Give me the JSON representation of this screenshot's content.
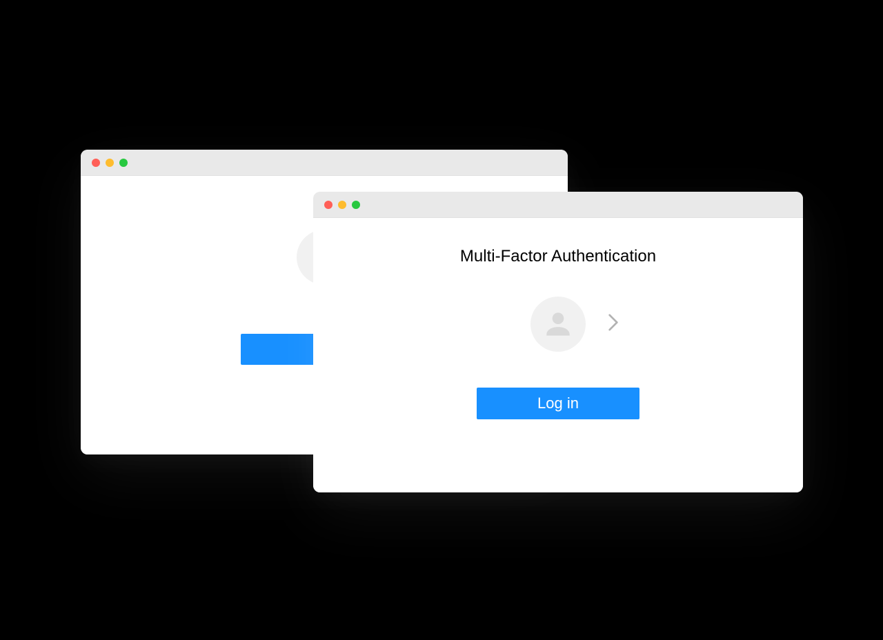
{
  "window_back": {
    "traffic_lights": [
      "close",
      "minimize",
      "zoom"
    ]
  },
  "window_front": {
    "traffic_lights": [
      "close",
      "minimize",
      "zoom"
    ],
    "title": "Multi-Factor Authentication",
    "login_button_label": "Log in",
    "colors": {
      "primary": "#1890ff",
      "titlebar": "#e9e9e9",
      "avatar_bg": "#f1f1f1"
    }
  }
}
